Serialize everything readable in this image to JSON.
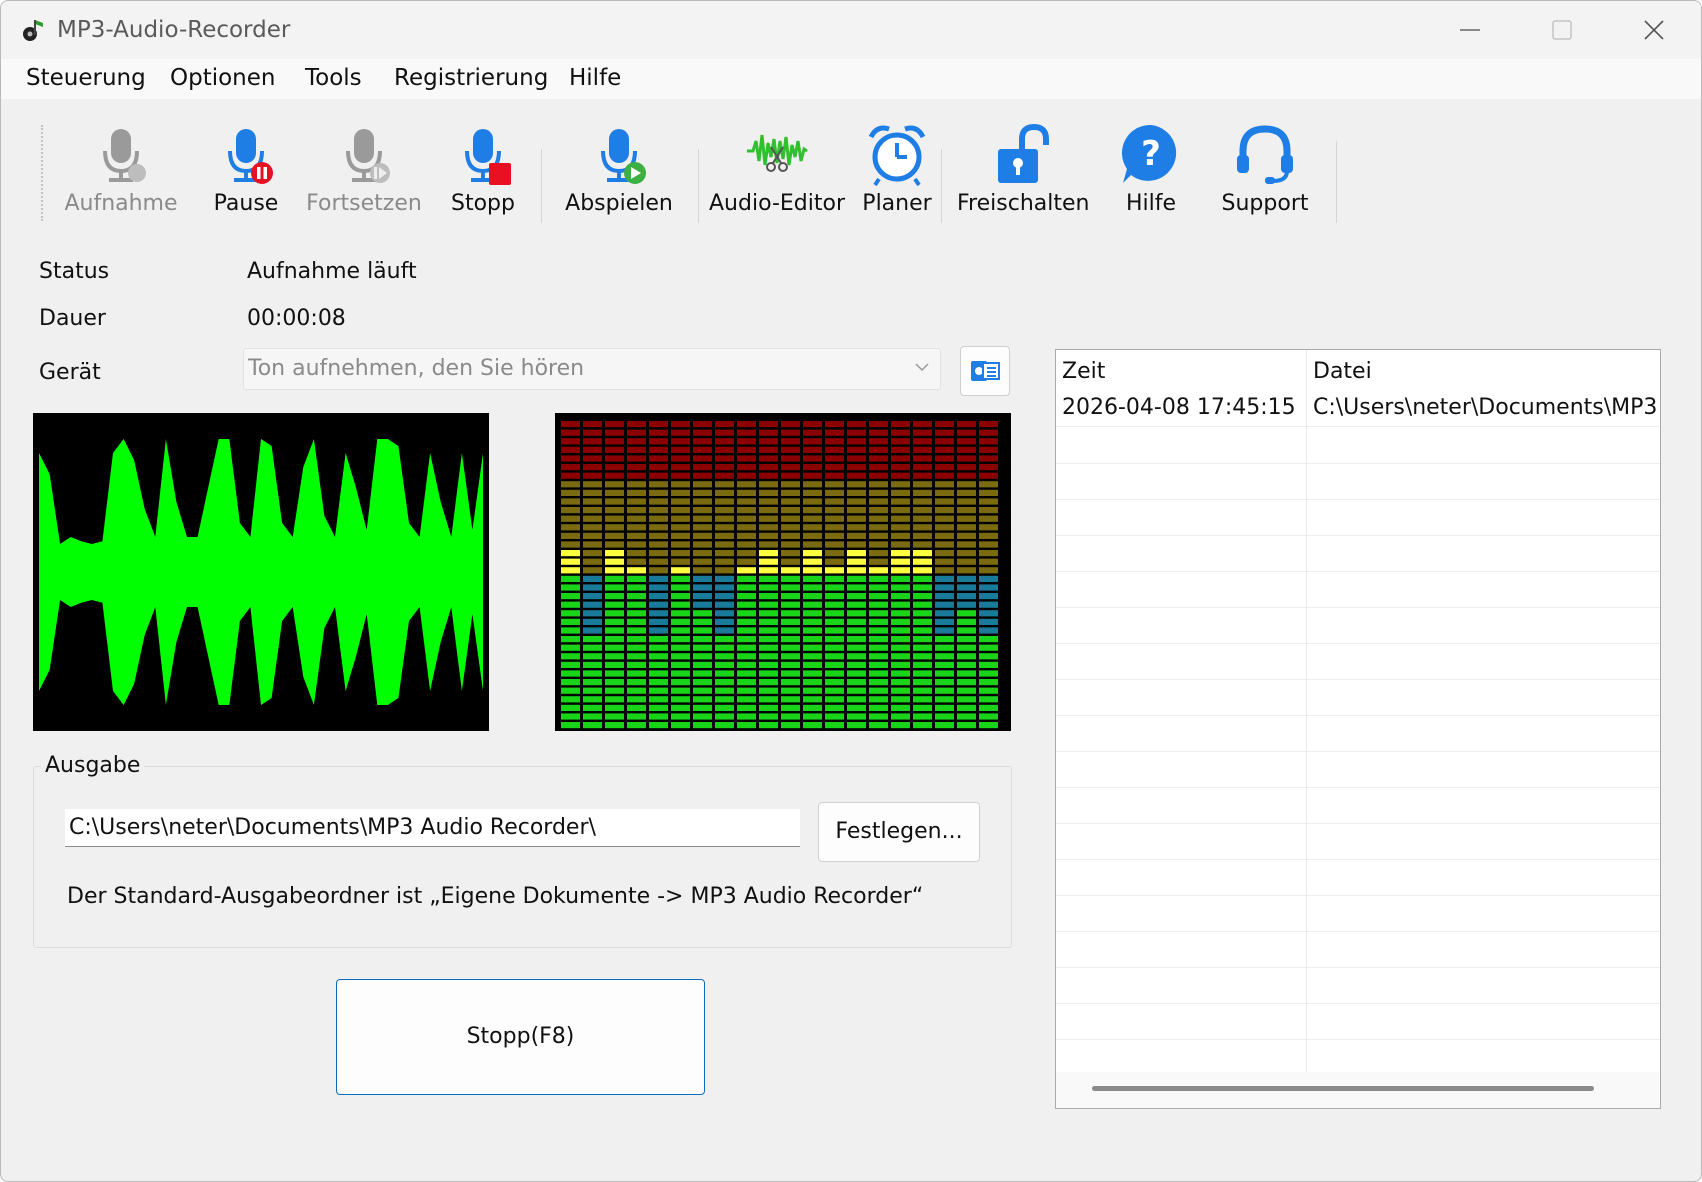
{
  "window": {
    "title": "MP3-Audio-Recorder"
  },
  "menu": [
    "Steuerung",
    "Optionen",
    "Tools",
    "Registrierung",
    "Hilfe"
  ],
  "toolbar": {
    "record": "Aufnahme",
    "pause": "Pause",
    "resume": "Fortsetzen",
    "stop": "Stopp",
    "play": "Abspielen",
    "editor": "Audio-Editor",
    "scheduler": "Planer",
    "unlock": "Freischalten",
    "help": "Hilfe",
    "support": "Support"
  },
  "status": {
    "label": "Status",
    "value": "Aufnahme läuft"
  },
  "duration": {
    "label": "Dauer",
    "value": "00:00:08"
  },
  "device": {
    "label": "Gerät",
    "value": "Ton aufnehmen, den Sie hören"
  },
  "output": {
    "title": "Ausgabe",
    "path": "C:\\Users\\neter\\Documents\\MP3 Audio Recorder\\",
    "set_button": "Festlegen...",
    "hint": "Der Standard-Ausgabeordner ist „Eigene Dokumente -> MP3 Audio Recorder“"
  },
  "stop_button": "Stopp(F8)",
  "recordings": {
    "columns": [
      "Zeit",
      "Datei"
    ],
    "rows": [
      {
        "time": "2026-04-08 17:45:15",
        "file": "C:\\Users\\neter\\Documents\\MP3"
      }
    ]
  },
  "colors": {
    "waveform": "#00ff00",
    "accent": "#0f6cbd",
    "icon_blue": "#1f7ee6",
    "icon_gray": "#9a9a9a",
    "stop_red": "#e81123",
    "spectrum_top": "#8b0000",
    "spectrum_upper": "#7a6a10",
    "spectrum_mid": "#ffff40",
    "spectrum_low": "#1a7a9a",
    "spectrum_bottom": "#19d419"
  },
  "spectrum_levels": [
    0.55,
    0.32,
    0.55,
    0.5,
    0.32,
    0.5,
    0.4,
    0.32,
    0.5,
    0.55,
    0.5,
    0.55,
    0.5,
    0.55,
    0.5,
    0.55,
    0.55,
    0.32,
    0.4,
    0.32
  ]
}
